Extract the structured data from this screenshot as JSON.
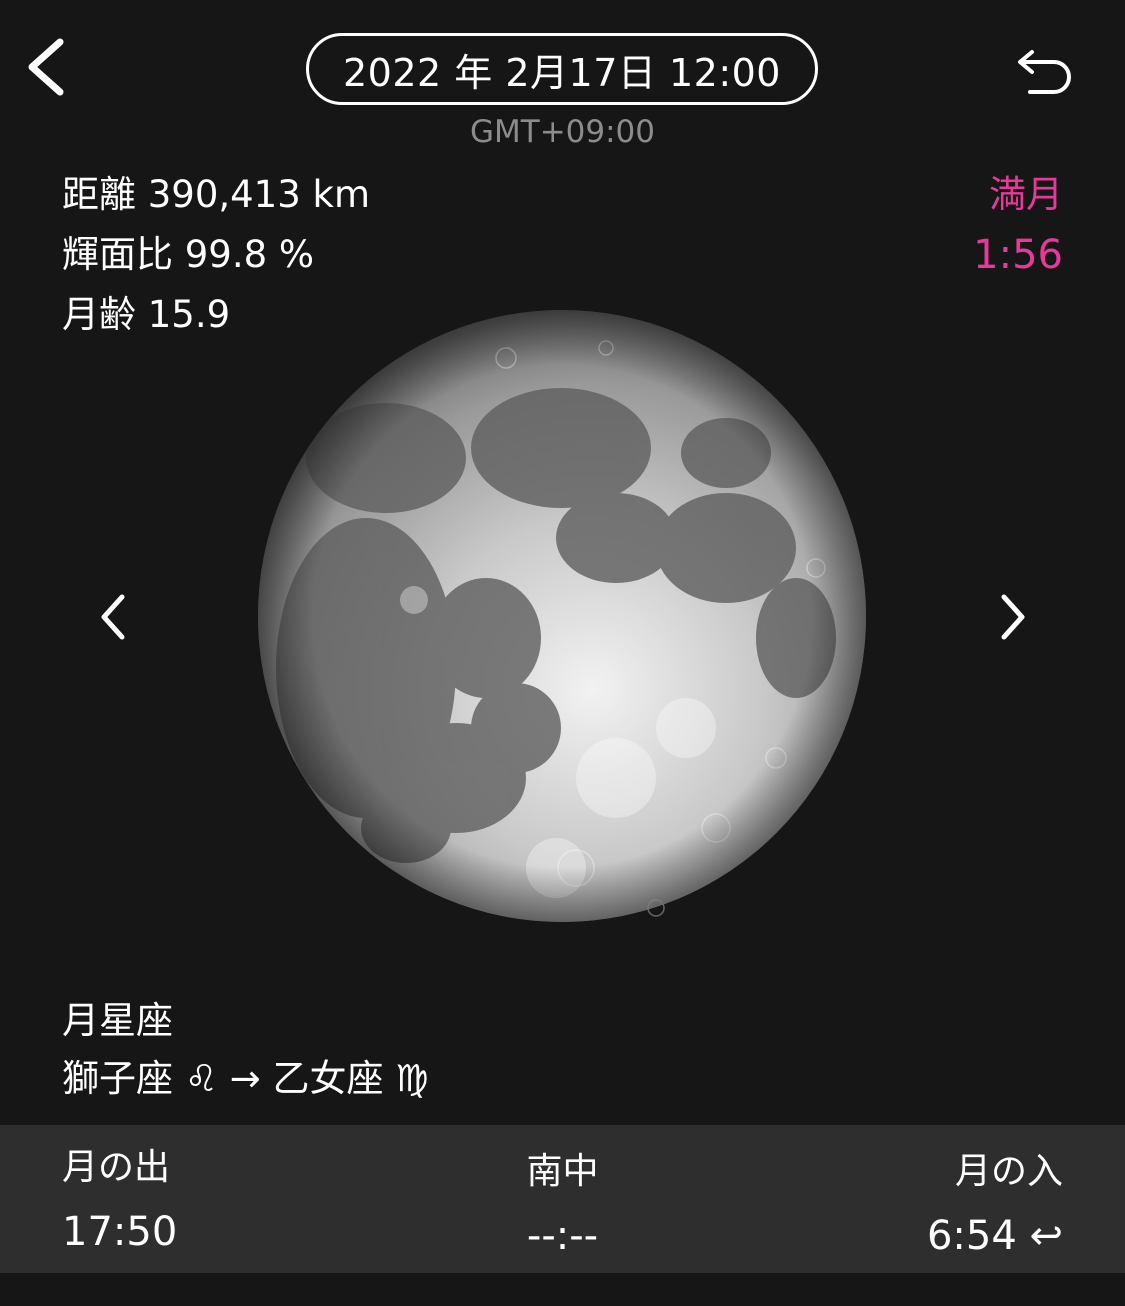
{
  "header": {
    "date_time": "2022 年 2月17日 12:00",
    "timezone": "GMT+09:00",
    "back_icon": "chevron-left-icon",
    "undo_icon": "undo-arrow-icon"
  },
  "info": {
    "distance": "距離 390,413 km",
    "illumination": "輝面比 99.8 %",
    "moon_age": "月齢 15.9",
    "phase_name": "満月",
    "phase_time": "1:56",
    "accent_color": "#e8399a"
  },
  "constellation": {
    "label": "月星座",
    "value": "獅子座 ♌︎ → 乙女座 ♍︎"
  },
  "times": {
    "rise_label": "月の出",
    "rise_value": "17:50",
    "transit_label": "南中",
    "transit_value": "--:--",
    "set_label": "月の入",
    "set_value": "6:54 ↩︎"
  }
}
